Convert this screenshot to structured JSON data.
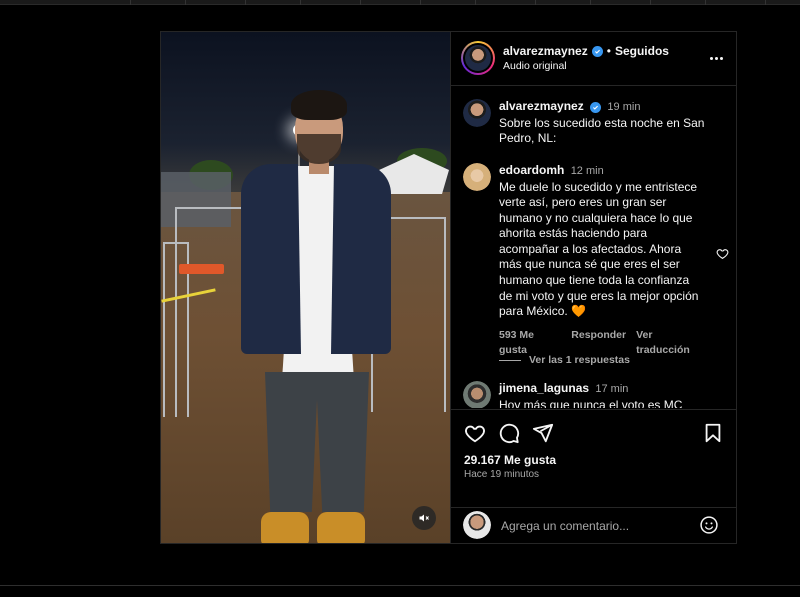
{
  "post": {
    "author": {
      "username": "alvarezmaynez",
      "verified": true,
      "follow_status": "Seguidos",
      "separator": "•",
      "audio": "Audio original"
    },
    "caption": {
      "username": "alvarezmaynez",
      "time": "19 min",
      "text": "Sobre los sucedido esta noche en San Pedro, NL:"
    },
    "comments": [
      {
        "username": "edoardomh",
        "time": "12 min",
        "text": "Me duele lo sucedido y me entristece verte así, pero eres un gran ser humano y no cualquiera hace lo que ahorita estás haciendo para acompañar a los afectados. Ahora más que nunca sé que eres el ser humano que tiene toda la confianza de mi voto y que eres la mejor opción para México. 🧡",
        "likes": "593 Me gusta",
        "reply": "Responder",
        "translate": "Ver traducción",
        "replies": "Ver las 1 respuestas"
      },
      {
        "username": "jimena_lagunas",
        "time": "17 min",
        "text": "Hoy más que nunca el voto es MC"
      }
    ],
    "likes": "29.167 Me gusta",
    "posted": "Hace 19 minutos",
    "comment_placeholder": "Agrega un comentario..."
  },
  "icons": {
    "verified": "verified-badge-icon",
    "more": "more-options-icon",
    "like": "heart-icon",
    "comment": "comment-icon",
    "share": "share-icon",
    "save": "bookmark-icon",
    "mute": "muted-speaker-icon",
    "emoji": "emoji-icon"
  },
  "colors": {
    "background": "#000000",
    "text": "#f5f5f5",
    "secondary_text": "#a8a8a8",
    "verified_blue": "#3897f0",
    "border": "#262626"
  }
}
